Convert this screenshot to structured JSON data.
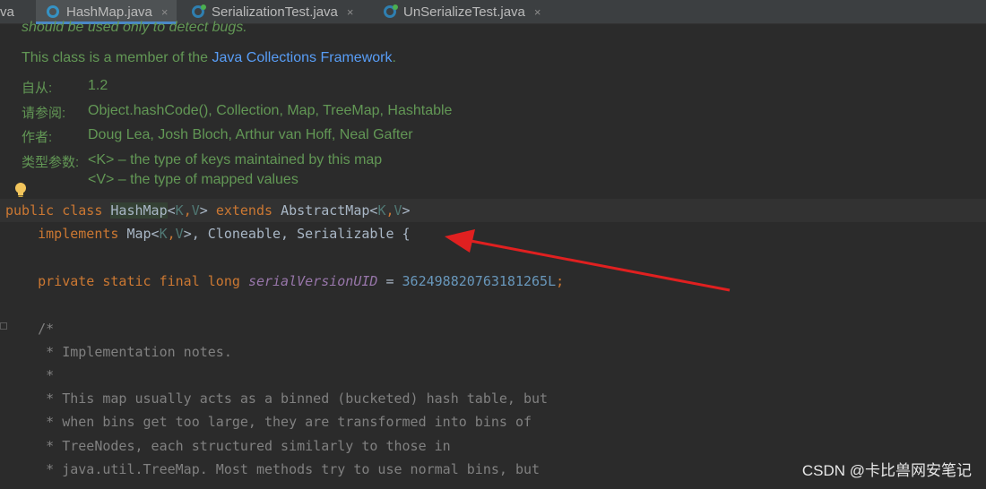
{
  "tabs": [
    {
      "label": "va",
      "active": false
    },
    {
      "label": "HashMap.java",
      "active": true
    },
    {
      "label": "SerializationTest.java",
      "active": false
    },
    {
      "label": "UnSerializeTest.java",
      "active": false
    }
  ],
  "tab_close_glyph": "×",
  "doc": {
    "line_detect": "should be used only to detect bugs.",
    "member_prefix": "This class is a member of the ",
    "member_link": "Java Collections Framework",
    "member_suffix": ".",
    "since_label": "自从:",
    "since_value": "1.2",
    "see_label": "请参阅:",
    "see_items": [
      "Object.hashCode()",
      "Collection",
      "Map",
      "TreeMap",
      "Hashtable"
    ],
    "see_separator": ", ",
    "author_label": "作者:",
    "author_value": "Doug Lea, Josh Bloch, Arthur van Hoff, Neal Gafter",
    "typeparam_label": "类型参数:",
    "typeparam_k": "<K> – the type of keys maintained by this map",
    "typeparam_v": "<V> – the type of mapped values"
  },
  "code": {
    "l1": {
      "kw1": "public class ",
      "name": "HashMap",
      "lt": "<",
      "K": "K",
      "comma": ",",
      "V": "V",
      "gt": "> ",
      "kw2": "extends ",
      "sup": "AbstractMap",
      "lt2": "<",
      "K2": "K",
      "comma2": ",",
      "V2": "V",
      "gt2": ">"
    },
    "l2": {
      "indent": "    ",
      "kw": "implements ",
      "a": "Map<",
      "K": "K",
      "comma": ",",
      "V": "V",
      "b": ">, Cloneable, Serializable {"
    },
    "l3": {
      "indent": "    ",
      "kw": "private static final long ",
      "fld": "serialVersionUID",
      "eq": " = ",
      "num": "362498820763181265L",
      "semi": ";"
    },
    "comments": [
      "    /*",
      "     * Implementation notes.",
      "     *",
      "     * This map usually acts as a binned (bucketed) hash table, but",
      "     * when bins get too large, they are transformed into bins of",
      "     * TreeNodes, each structured similarly to those in",
      "     * java.util.TreeMap. Most methods try to use normal bins, but"
    ]
  },
  "colors": {
    "arrow": "#e02020",
    "accent": "#4a88c7"
  },
  "watermark": "CSDN @卡比兽网安笔记"
}
